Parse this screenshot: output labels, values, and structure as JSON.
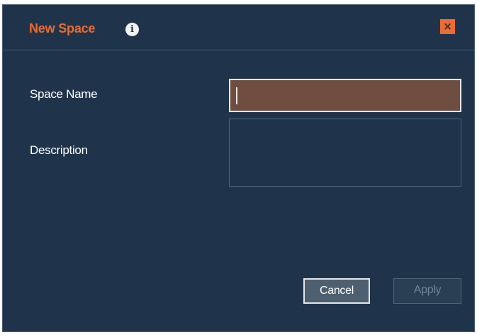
{
  "dialog": {
    "title": "New Space",
    "info_icon": "info-icon",
    "close_icon": "close-icon",
    "close_glyph": "×"
  },
  "form": {
    "space_name_label": "Space Name",
    "space_name_value": "",
    "description_label": "Description",
    "description_value": ""
  },
  "buttons": {
    "cancel_label": "Cancel",
    "apply_label": "Apply",
    "apply_enabled": false
  },
  "colors": {
    "background": "#1f344a",
    "accent": "#ee6a30",
    "active_input": "#6f4e41"
  }
}
